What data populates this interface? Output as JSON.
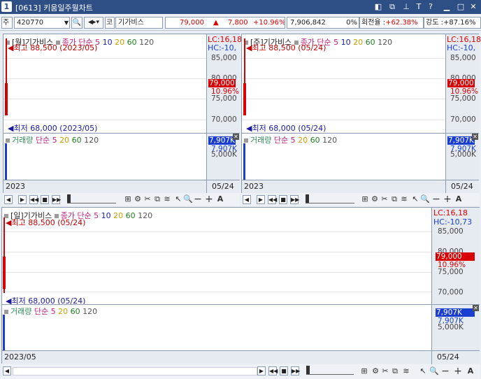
{
  "window": {
    "number": "1",
    "title": "[0613] 키움일주월차트",
    "controls": [
      "◧",
      "⧉",
      "📌",
      "T",
      "?",
      "▁",
      "□",
      "✕"
    ]
  },
  "toolbar": {
    "market_select": "주",
    "code": "420770",
    "market_tag": "코",
    "name": "기가비스",
    "price": "79,000",
    "change_arrow": "▲",
    "change": "7,800",
    "change_pct": "+10.96%",
    "volume": "7,906,842",
    "vol_pct": "0%",
    "turnover_label": "회전율 :",
    "turnover": "+62.38%",
    "strength_label": "강도 :",
    "strength": "+87.16%"
  },
  "charts": {
    "monthly": {
      "legend_title": "[월]기가비스",
      "ma_label": "종가 단순",
      "ma_periods": [
        "5",
        "10",
        "20",
        "60",
        "120"
      ],
      "high": "최고 88,500 (2023/05)",
      "low": "최저 68,000 (2023/05)",
      "lc": "LC:16,18",
      "hc": "HC:-10,",
      "y_ticks": [
        "85,000",
        "80,000",
        "75,000",
        "70,000"
      ],
      "price_label": "79,000",
      "pct_label": "10.96%",
      "vol_legend": "거래량",
      "vol_ma_label": "단순",
      "vol_ma_periods": [
        "5",
        "20",
        "60",
        "120"
      ],
      "vol_label": "7,907K",
      "vol_tick": "7,907K",
      "vol_tick2": "5,000K",
      "x_left": "2023",
      "x_right": "05/24"
    },
    "weekly": {
      "legend_title": "[주]기가비스",
      "ma_label": "종가 단순",
      "ma_periods": [
        "5",
        "10",
        "20",
        "60",
        "120"
      ],
      "high": "최고 88,500 (05/24)",
      "low": "최저 68,000 (05/24)",
      "lc": "LC:16,18",
      "hc": "HC:-10,",
      "y_ticks": [
        "85,000",
        "80,000",
        "75,000",
        "70,000"
      ],
      "price_label": "79,000",
      "pct_label": "10.96%",
      "vol_legend": "거래량",
      "vol_ma_label": "단순",
      "vol_ma_periods": [
        "5",
        "20",
        "60",
        "120"
      ],
      "vol_label": "7,907K",
      "vol_tick": "7,907K",
      "vol_tick2": "5,000K",
      "x_left": "2023",
      "x_right": "05/24"
    },
    "daily": {
      "legend_title": "[일]기가비스",
      "ma_label": "종가 단순",
      "ma_periods": [
        "5",
        "10",
        "20",
        "60",
        "120"
      ],
      "high": "최고 88,500 (05/24)",
      "low": "최저 68,000 (05/24)",
      "lc": "LC:16,18",
      "hc": "HC:-10,73",
      "y_ticks": [
        "85,000",
        "80,000",
        "75,000",
        "70,000"
      ],
      "price_label": "79,000",
      "pct_label": "10.96%",
      "vol_legend": "거래량",
      "vol_ma_label": "단순",
      "vol_ma_periods": [
        "5",
        "20",
        "60",
        "120"
      ],
      "vol_label": "7,907K",
      "vol_tick": "7,907K",
      "vol_tick2": "5,000K",
      "x_left": "2023/05",
      "x_right": "05/24"
    }
  },
  "colors": {
    "ma5": "#c02080",
    "ma10": "#1a1aa0",
    "ma20": "#d0a000",
    "ma60": "#208020",
    "ma120": "#555555",
    "up": "#d80000",
    "volume": "#1a3fd0",
    "vol_text": "#2e8b57"
  }
}
